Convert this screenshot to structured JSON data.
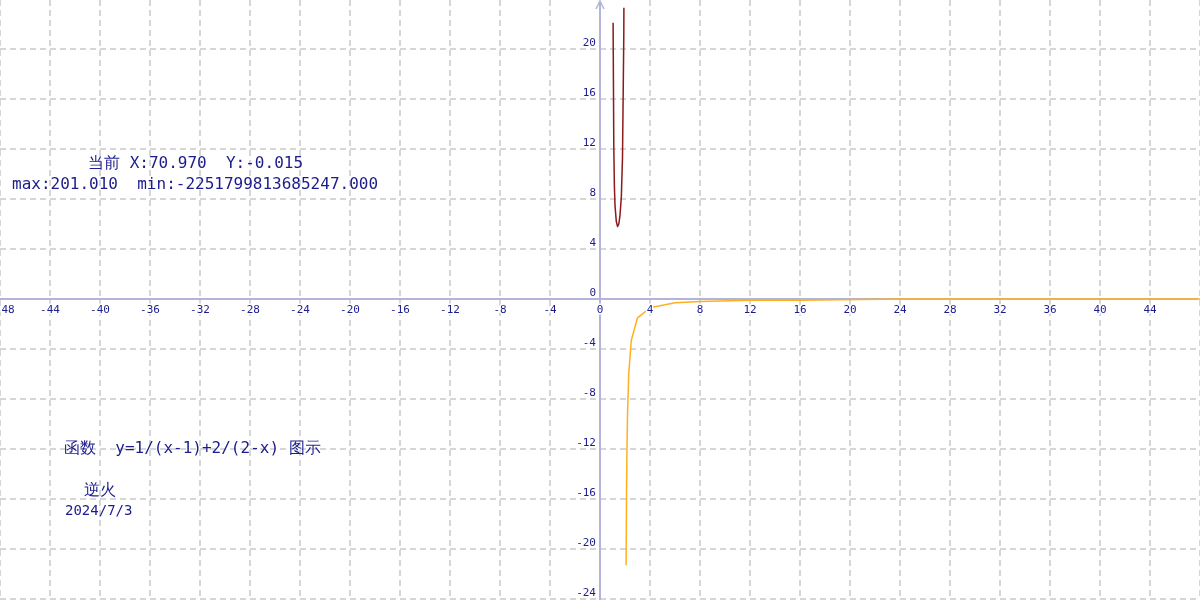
{
  "readout": {
    "current": "当前 X:70.970  Y:-0.015",
    "range": "max:201.010  min:-2251799813685247.000"
  },
  "caption": {
    "title": "函数  y=1/(x-1)+2/(2-x) 图示",
    "author": "逆火",
    "date": "2024/7/3"
  },
  "chart_data": {
    "type": "line",
    "grid": true,
    "xlim": [
      -48,
      48
    ],
    "ylim": [
      -24.1,
      23.9
    ],
    "xticks": [
      {
        "value": -48,
        "label": "48"
      },
      -44,
      -40,
      -36,
      -32,
      -28,
      -24,
      -20,
      -16,
      -12,
      -8,
      -4,
      0,
      4,
      8,
      12,
      16,
      20,
      24,
      28,
      32,
      36,
      40,
      44
    ],
    "yticks": [
      -24,
      -20,
      -16,
      -12,
      -8,
      -4,
      0,
      4,
      8,
      12,
      16,
      20
    ],
    "x": [
      1.05,
      1.1,
      1.15,
      1.2,
      1.3,
      1.41,
      1.5,
      1.6,
      1.7,
      1.8,
      1.9,
      1.91,
      2.09,
      2.12,
      2.15,
      2.2,
      2.3,
      2.5,
      3,
      4,
      6,
      8,
      12,
      16,
      24,
      32,
      48
    ],
    "series": [
      {
        "color": "#8b1a1a",
        "values": [
          22.1,
          12.2,
          9.0,
          7.5,
          6.2,
          5.8,
          6.0,
          6.7,
          8.1,
          11.3,
          21.1,
          23.3,
          null,
          null,
          null,
          null,
          null,
          null,
          null,
          null,
          null,
          null,
          null,
          null,
          null,
          null,
          null
        ]
      },
      {
        "color": "#ffb020",
        "values": [
          null,
          null,
          null,
          null,
          null,
          null,
          null,
          null,
          null,
          null,
          null,
          null,
          -21.3,
          -15.8,
          -12.5,
          -9.2,
          -5.9,
          -3.3,
          -1.5,
          -0.7,
          -0.3,
          -0.2,
          -0.1,
          -0.1,
          0,
          0,
          0
        ]
      }
    ]
  }
}
